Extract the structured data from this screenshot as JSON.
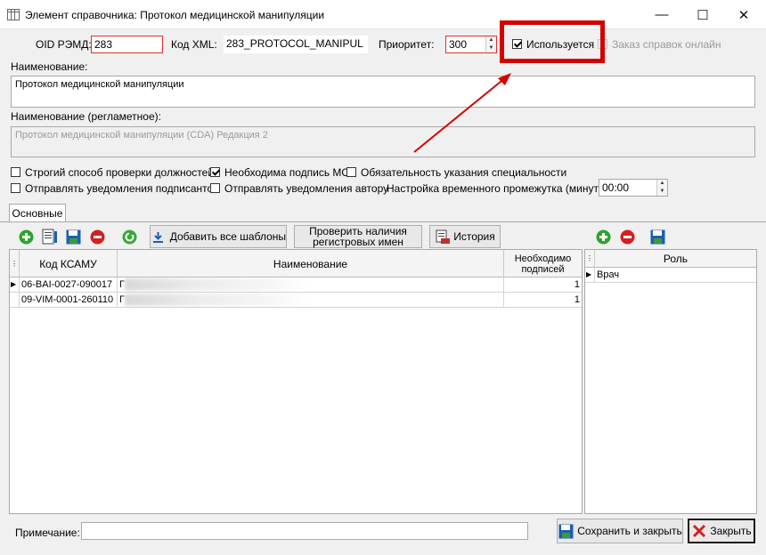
{
  "window": {
    "title": "Элемент справочника: Протокол медицинской манипуляции",
    "min": "—",
    "max": "☐",
    "close": "✕"
  },
  "fields": {
    "oid_label": "OID РЭМД:",
    "oid_value": "283",
    "xml_label": "Код XML:",
    "xml_value": "283_PROTOCOL_MANIPUL",
    "priority_label": "Приоритет:",
    "priority_value": "300",
    "used_label": "Используется",
    "order_label": "Заказ справок онлайн",
    "name_label": "Наименование:",
    "name_value": "Протокол медицинской манипуляции",
    "reg_name_label": "Наименование (регламетное):",
    "reg_name_value": "Протокол медицинской манипуляции (CDA) Редакция 2"
  },
  "options": {
    "strict_check": "Строгий способ проверки должностей",
    "mo_sign": "Необходима подпись МО",
    "specialty_required": "Обязательность указания специальности",
    "notify_signers": "Отправлять уведомления подписантов",
    "notify_author": "Отправлять уведомления автору",
    "time_setting_label": "Настройка временного промежутка (минуты):",
    "time_setting_value": "00:00"
  },
  "tabs": [
    "Основные"
  ],
  "toolbar": {
    "add_all_templates": "Добавить все шаблоны",
    "check_names_line1": "Проверить наличия",
    "check_names_line2": "регистровых имен",
    "history": "История"
  },
  "table": {
    "columns": [
      "Код КСАМУ",
      "Наименование",
      "Необходимо подписей"
    ],
    "rows": [
      {
        "code": "06-BAI-0027-090017",
        "name": "Г",
        "signatures": "1"
      },
      {
        "code": "09-VIM-0001-260110",
        "name": "Г",
        "signatures": "1"
      }
    ]
  },
  "roles": {
    "column": "Роль",
    "rows": [
      "Врач"
    ]
  },
  "footer": {
    "note_label": "Примечание:",
    "note_value": "",
    "save_close": "Сохранить и закрыть",
    "close": "Закрыть"
  },
  "colors": {
    "highlight": "#d40000",
    "arrow": "#d40000",
    "add_icon": "#2aa52a",
    "remove_icon": "#d42020",
    "save_icon": "#1c5fb0"
  }
}
